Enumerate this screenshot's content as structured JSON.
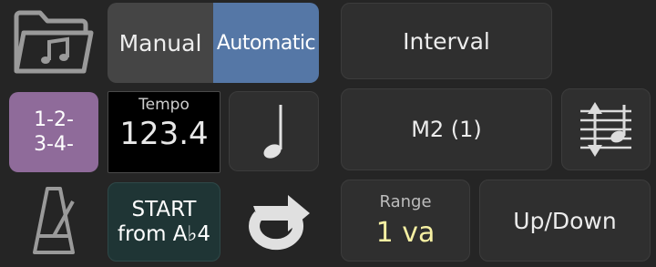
{
  "mode": {
    "manual": "Manual",
    "automatic": "Automatic",
    "selected": "Automatic"
  },
  "count_pattern": {
    "line1": "1-2-",
    "line2": "3-4-"
  },
  "tempo": {
    "label": "Tempo",
    "value": "123.4"
  },
  "start": {
    "line1": "START",
    "line2": "from A♭4"
  },
  "interval": {
    "label": "Interval",
    "value": "M2 (1)"
  },
  "range": {
    "label": "Range",
    "value": "1 va"
  },
  "direction": {
    "label": "Up/Down"
  },
  "icons": [
    "folder-music-icon",
    "quarter-note-icon",
    "metronome-icon",
    "loop-icon",
    "staff-up-down-icon"
  ],
  "colors": {
    "automatic_active": "#5577a6",
    "count_pattern": "#8f6b9a",
    "start_button": "#1f3535",
    "range_value": "#f6f0a3"
  }
}
